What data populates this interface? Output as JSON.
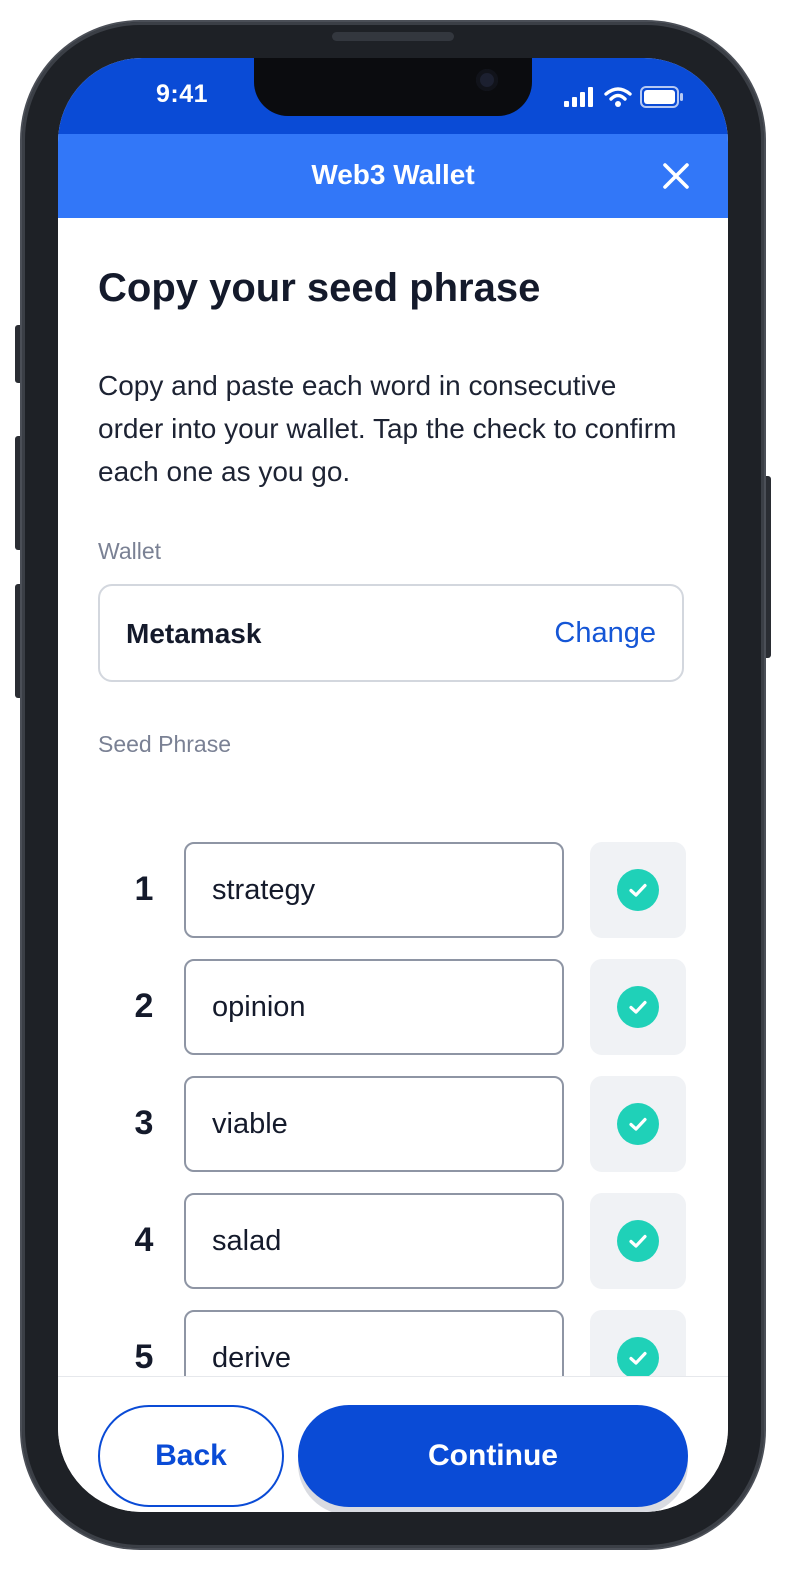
{
  "status_bar": {
    "time": "9:41"
  },
  "header": {
    "title": "Web3 Wallet"
  },
  "page": {
    "title": "Copy your seed phrase",
    "description": "Copy and paste each word in consecutive order into your wallet. Tap the check to confirm each one as you go."
  },
  "wallet": {
    "label": "Wallet",
    "name": "Metamask",
    "change_label": "Change"
  },
  "seed_phrase": {
    "label": "Seed Phrase",
    "words": [
      {
        "number": "1",
        "word": "strategy",
        "confirmed": true
      },
      {
        "number": "2",
        "word": "opinion",
        "confirmed": true
      },
      {
        "number": "3",
        "word": "viable",
        "confirmed": true
      },
      {
        "number": "4",
        "word": "salad",
        "confirmed": true
      },
      {
        "number": "5",
        "word": "derive",
        "confirmed": true
      }
    ]
  },
  "footer": {
    "back_label": "Back",
    "continue_label": "Continue"
  },
  "colors": {
    "primary": "#0a4bd6",
    "header": "#3277f8",
    "check": "#1fd1b8",
    "text": "#141a2b",
    "muted": "#7a8194"
  },
  "icons": {
    "close": "close-icon",
    "check": "check-icon",
    "signal": "cellular-signal-icon",
    "wifi": "wifi-icon",
    "battery": "battery-icon"
  }
}
